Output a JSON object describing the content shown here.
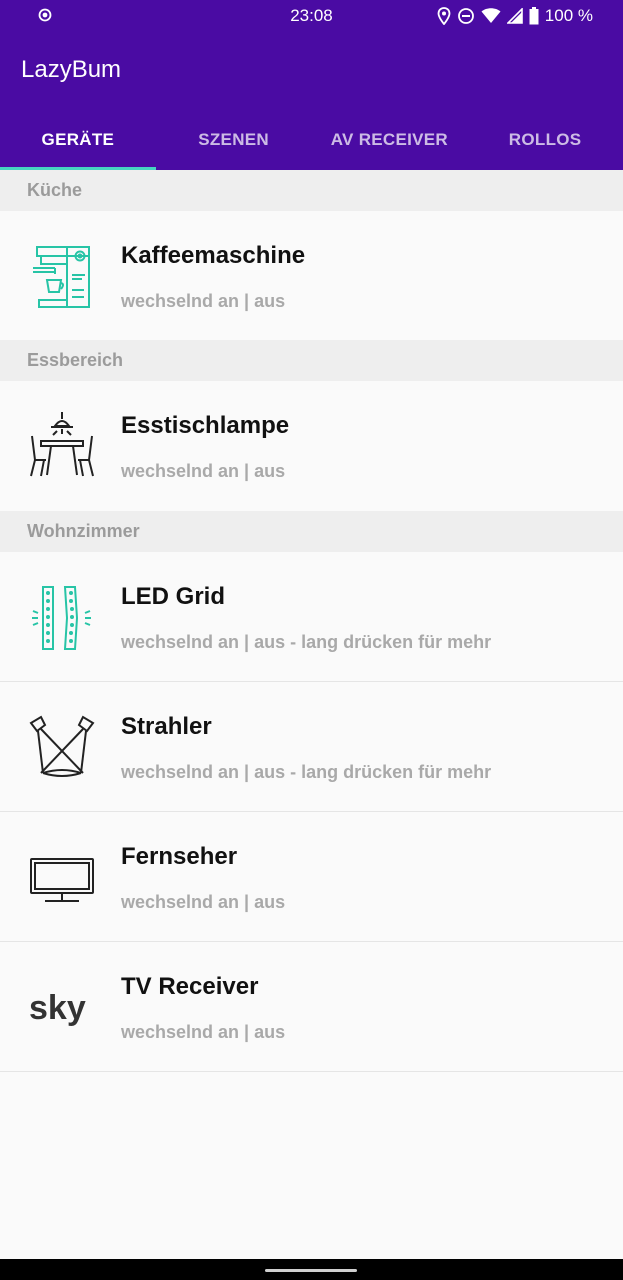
{
  "status": {
    "time": "23:08",
    "battery": "100 %"
  },
  "app": {
    "title": "LazyBum"
  },
  "tabs": [
    "GERÄTE",
    "SZENEN",
    "AV RECEIVER",
    "ROLLOS"
  ],
  "sections": [
    {
      "title": "Küche",
      "devices": [
        {
          "name": "Kaffeemaschine",
          "subtitle": "wechselnd an | aus",
          "icon": "coffee-machine-icon"
        }
      ]
    },
    {
      "title": "Essbereich",
      "devices": [
        {
          "name": "Esstischlampe",
          "subtitle": "wechselnd an | aus",
          "icon": "dining-lamp-icon"
        }
      ]
    },
    {
      "title": "Wohnzimmer",
      "devices": [
        {
          "name": "LED Grid",
          "subtitle": "wechselnd an | aus - lang drücken für mehr",
          "icon": "led-grid-icon"
        },
        {
          "name": "Strahler",
          "subtitle": "wechselnd an | aus - lang drücken für mehr",
          "icon": "spotlight-icon"
        },
        {
          "name": "Fernseher",
          "subtitle": "wechselnd an | aus",
          "icon": "tv-icon"
        },
        {
          "name": "TV Receiver",
          "subtitle": "wechselnd an | aus",
          "icon": "sky-logo-icon",
          "logo_text": "sky"
        }
      ]
    }
  ],
  "colors": {
    "primary": "#4a0ba3",
    "accent": "#46d4c1",
    "section_bg": "#eeeeee",
    "subtitle": "#a9a9a9"
  }
}
